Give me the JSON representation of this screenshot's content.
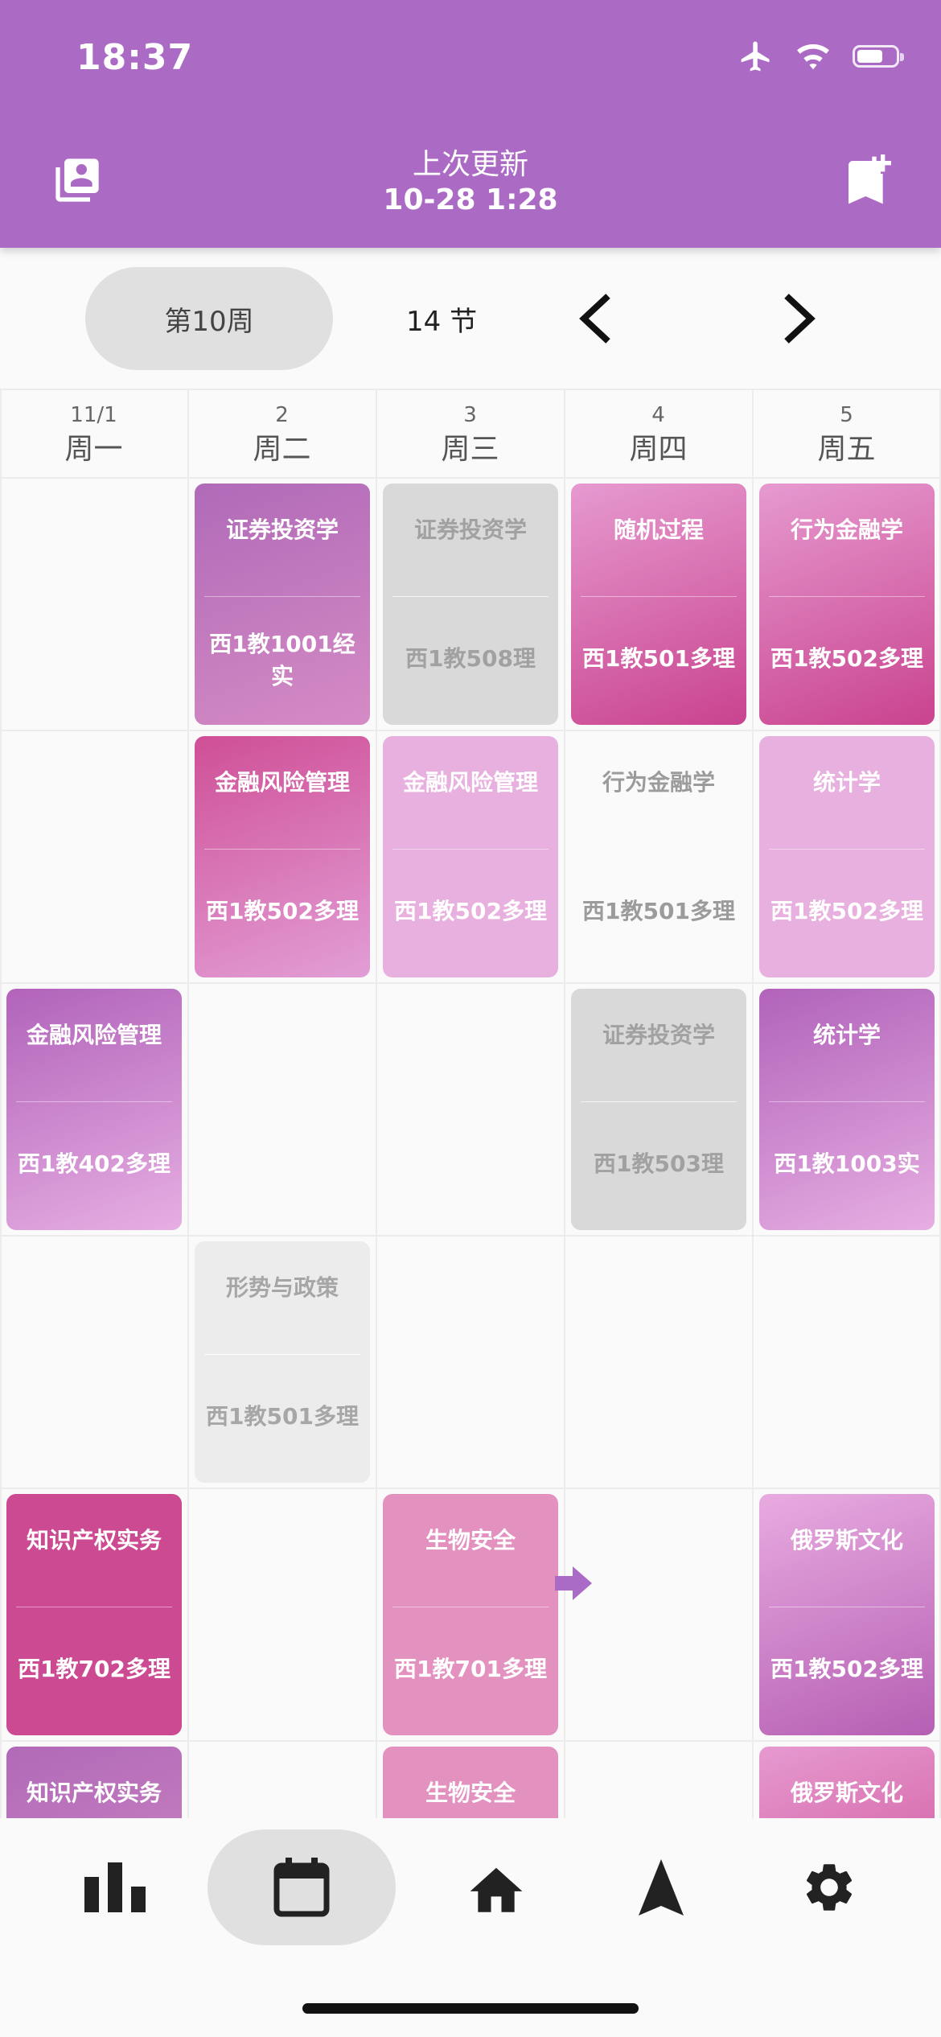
{
  "status_bar": {
    "time": "18:37"
  },
  "header": {
    "title": "上次更新",
    "subtitle": "10-28 1:28"
  },
  "toolbar": {
    "week": "第10周",
    "sections": "14 节"
  },
  "days": [
    {
      "date": "11/1",
      "name": "周一"
    },
    {
      "date": "2",
      "name": "周二"
    },
    {
      "date": "3",
      "name": "周三"
    },
    {
      "date": "4",
      "name": "周四"
    },
    {
      "date": "5",
      "name": "周五"
    }
  ],
  "courses": [
    {
      "name": "证券投资学",
      "room": "西1教1001经实",
      "day": 2,
      "slot": 1,
      "style": "purple-pink"
    },
    {
      "name": "证券投资学",
      "room": "西1教508理",
      "day": 3,
      "slot": 1,
      "style": "grey"
    },
    {
      "name": "随机过程",
      "room": "西1教501多理",
      "day": 4,
      "slot": 1,
      "style": "pink-magenta"
    },
    {
      "name": "行为金融学",
      "room": "西1教502多理",
      "day": 5,
      "slot": 1,
      "style": "pink-magenta"
    },
    {
      "name": "金融风险管理",
      "room": "西1教502多理",
      "day": 2,
      "slot": 2,
      "style": "magenta-pink"
    },
    {
      "name": "金融风险管理",
      "room": "西1教502多理",
      "day": 3,
      "slot": 2,
      "style": "light-pink"
    },
    {
      "name": "行为金融学",
      "room": "西1教501多理",
      "day": 4,
      "slot": 2,
      "style": "white"
    },
    {
      "name": "统计学",
      "room": "西1教502多理",
      "day": 5,
      "slot": 2,
      "style": "light-pink"
    },
    {
      "name": "金融风险管理",
      "room": "西1教402多理",
      "day": 1,
      "slot": 3,
      "style": "purple-light"
    },
    {
      "name": "证券投资学",
      "room": "西1教503理",
      "day": 4,
      "slot": 3,
      "style": "grey"
    },
    {
      "name": "统计学",
      "room": "西1教1003实",
      "day": 5,
      "slot": 3,
      "style": "purple-light"
    },
    {
      "name": "形势与政策",
      "room": "西1教501多理",
      "day": 2,
      "slot": 4,
      "style": "lightgrey"
    },
    {
      "name": "知识产权实务",
      "room": "西1教702多理",
      "day": 1,
      "slot": 5,
      "style": "magenta"
    },
    {
      "name": "生物安全",
      "room": "西1教701多理",
      "day": 3,
      "slot": 5,
      "style": "rose"
    },
    {
      "name": "俄罗斯文化",
      "room": "西1教502多理",
      "day": 5,
      "slot": 5,
      "style": "pink-purple"
    },
    {
      "name": "知识产权实务",
      "room": "",
      "day": 1,
      "slot": 6,
      "style": "purple-pink"
    },
    {
      "name": "生物安全",
      "room": "",
      "day": 3,
      "slot": 6,
      "style": "rose"
    },
    {
      "name": "俄罗斯文化",
      "room": "",
      "day": 5,
      "slot": 6,
      "style": "pink-magenta"
    }
  ],
  "styles": {
    "purple-pink": "linear-gradient(160deg,#b06ab8 0%,#d58bc4 100%)",
    "pink-magenta": "linear-gradient(160deg,#e69ad0 0%,#c9438e 100%)",
    "magenta-pink": "linear-gradient(160deg,#cf4f96 0%,#e29ed6 100%)",
    "light-pink": "#e8b0de",
    "purple-light": "linear-gradient(160deg,#b163ba 0%,#e7aee2 100%)",
    "magenta": "#cc4a92",
    "rose": "#e392c0",
    "pink-purple": "linear-gradient(160deg,#e8abe0 0%,#b55fb3 100%)"
  },
  "nav": [
    {
      "name": "stats-icon"
    },
    {
      "name": "calendar-icon"
    },
    {
      "name": "home-icon"
    },
    {
      "name": "navigation-icon"
    },
    {
      "name": "settings-icon"
    }
  ]
}
